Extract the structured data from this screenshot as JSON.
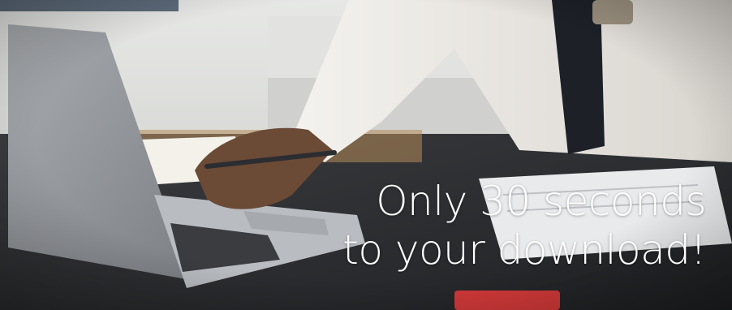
{
  "banner": {
    "headline_line1": "Only 30 seconds",
    "headline_line2": "to your download!",
    "colors": {
      "headline_text": "#ffffff",
      "shirt": "#e9e5df",
      "tie": "#1d2027",
      "desk": "#2a2c30",
      "laptop": "#b9bcc0",
      "background_wall": "#dadbd8",
      "note_red": "#d63a3a"
    }
  }
}
